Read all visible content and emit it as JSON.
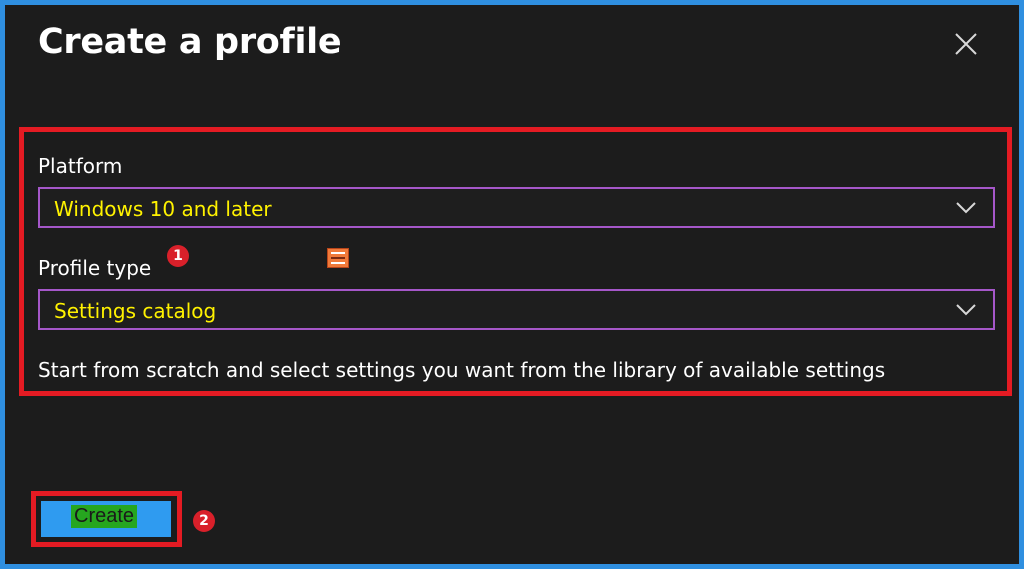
{
  "header": {
    "title": "Create a profile"
  },
  "form": {
    "platform_label": "Platform",
    "platform_value": "Windows 10 and later",
    "profile_type_label": "Profile type",
    "profile_type_value": "Settings catalog",
    "description": "Start from scratch and select settings you want from the library of available settings"
  },
  "actions": {
    "create_label": "Create"
  },
  "annotations": {
    "marker_1": "1",
    "marker_2": "2"
  },
  "icons": {
    "close": "close-icon",
    "chevron": "chevron-down-icon",
    "logo": "site-logo-icon"
  },
  "colors": {
    "background": "#1c1c1c",
    "frame_border": "#2f8fe0",
    "highlight_red": "#e41b23",
    "select_border": "#a557c9",
    "select_text": "#fff200",
    "create_button": "#2f9bf0"
  }
}
